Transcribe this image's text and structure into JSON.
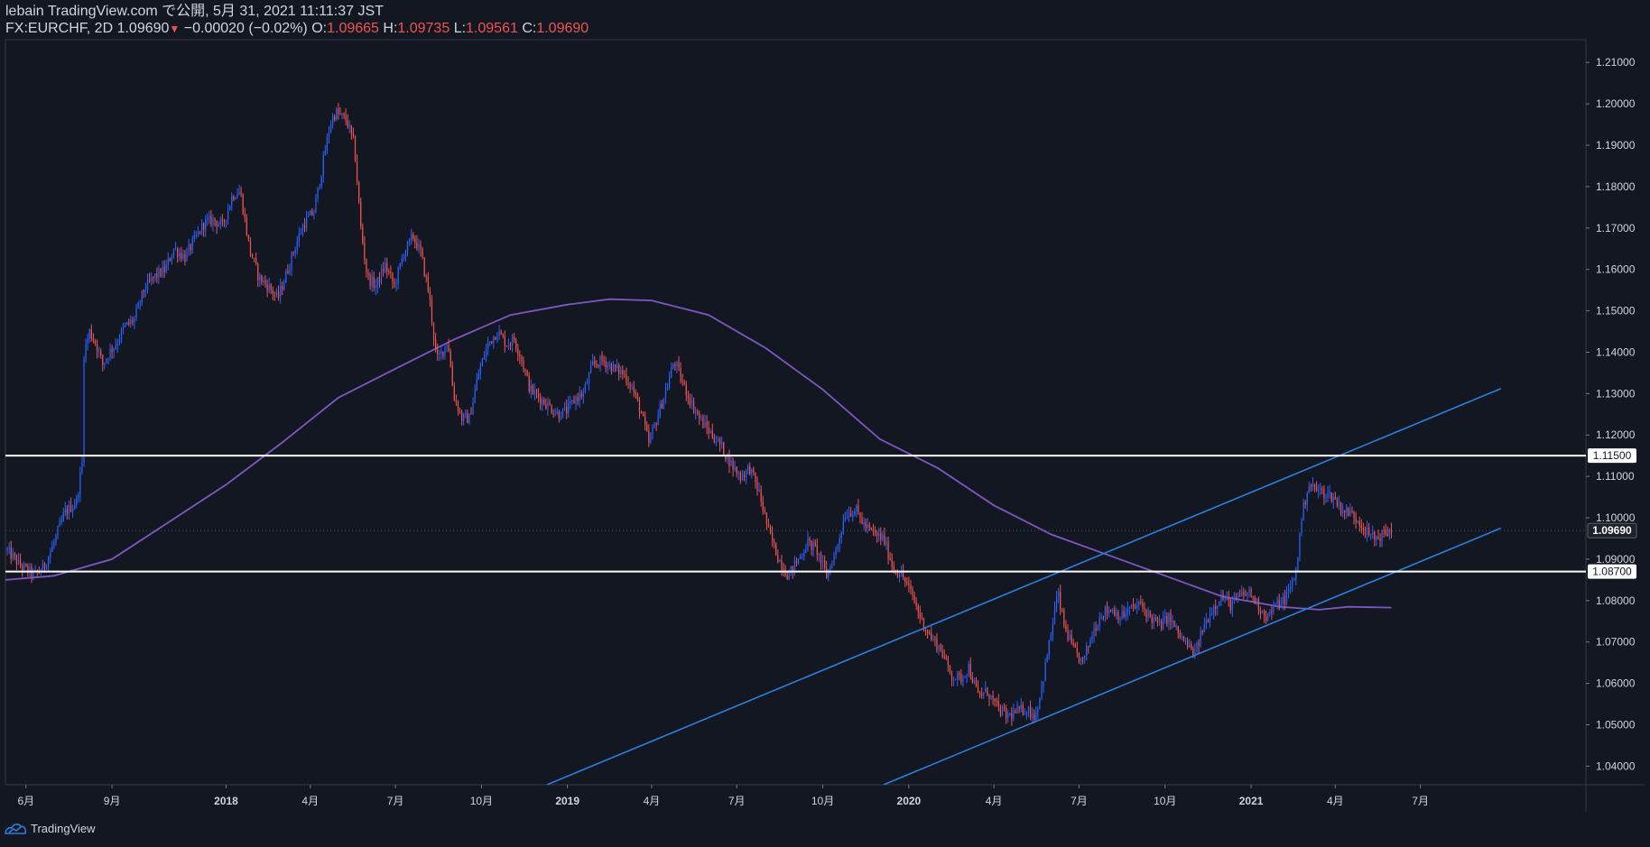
{
  "header": {
    "line1": "lebain TradingView.com で公開, 5月 31, 2021 11:11:37 JST",
    "symbol": "FX:EURCHF, 2D 1.09690",
    "arrow": "▼",
    "change": "−0.00020 (−0.02%)",
    "o_label": "O:",
    "o_value": "1.09665",
    "h_label": "H:",
    "h_value": "1.09735",
    "l_label": "L:",
    "l_value": "1.09561",
    "c_label": "C:",
    "c_value": "1.09690"
  },
  "footer": {
    "brand": "TradingView"
  },
  "colors": {
    "background": "#131722",
    "up": "#2962ff",
    "down": "#ef5350",
    "ma": "#7e57c2",
    "trendline": "#2a7fdf",
    "level": "#ffffff",
    "text": "#d1d4dc"
  },
  "chart_data": {
    "type": "candlestick",
    "symbol": "FX:EURCHF",
    "interval": "2D",
    "ylim": [
      1.0355,
      1.2155
    ],
    "y_ticks": [
      "1.21000",
      "1.20000",
      "1.19000",
      "1.18000",
      "1.17000",
      "1.16000",
      "1.15000",
      "1.14000",
      "1.13000",
      "1.12000",
      "1.11000",
      "1.10000",
      "1.09000",
      "1.08000",
      "1.07000",
      "1.06000",
      "1.05000",
      "1.04000"
    ],
    "x_ticks": [
      {
        "label": "6月",
        "date": "2017-06-01",
        "bold": false
      },
      {
        "label": "9月",
        "date": "2017-09-01",
        "bold": false
      },
      {
        "label": "2018",
        "date": "2018-01-01",
        "bold": true
      },
      {
        "label": "4月",
        "date": "2018-04-01",
        "bold": false
      },
      {
        "label": "7月",
        "date": "2018-07-01",
        "bold": false
      },
      {
        "label": "10月",
        "date": "2018-10-01",
        "bold": false
      },
      {
        "label": "2019",
        "date": "2019-01-01",
        "bold": true
      },
      {
        "label": "4月",
        "date": "2019-04-01",
        "bold": false
      },
      {
        "label": "7月",
        "date": "2019-07-01",
        "bold": false
      },
      {
        "label": "10月",
        "date": "2019-10-01",
        "bold": false
      },
      {
        "label": "2020",
        "date": "2020-01-01",
        "bold": true
      },
      {
        "label": "4月",
        "date": "2020-04-01",
        "bold": false
      },
      {
        "label": "7月",
        "date": "2020-07-01",
        "bold": false
      },
      {
        "label": "10月",
        "date": "2020-10-01",
        "bold": false
      },
      {
        "label": "2021",
        "date": "2021-01-01",
        "bold": true
      },
      {
        "label": "4月",
        "date": "2021-04-01",
        "bold": false
      },
      {
        "label": "7月",
        "date": "2021-07-01",
        "bold": false
      }
    ],
    "close_path": [
      [
        "2017-05-12",
        1.092
      ],
      [
        "2017-05-28",
        1.088
      ],
      [
        "2017-06-10",
        1.0862
      ],
      [
        "2017-06-20",
        1.088
      ],
      [
        "2017-07-01",
        1.094
      ],
      [
        "2017-07-12",
        1.101
      ],
      [
        "2017-07-25",
        1.104
      ],
      [
        "2017-07-31",
        1.113
      ],
      [
        "2017-08-02",
        1.14
      ],
      [
        "2017-08-08",
        1.145
      ],
      [
        "2017-08-15",
        1.142
      ],
      [
        "2017-08-22",
        1.137
      ],
      [
        "2017-08-29",
        1.14
      ],
      [
        "2017-09-05",
        1.142
      ],
      [
        "2017-09-14",
        1.146
      ],
      [
        "2017-09-25",
        1.148
      ],
      [
        "2017-10-05",
        1.155
      ],
      [
        "2017-10-15",
        1.158
      ],
      [
        "2017-10-28",
        1.16
      ],
      [
        "2017-11-06",
        1.165
      ],
      [
        "2017-11-18",
        1.163
      ],
      [
        "2017-11-28",
        1.167
      ],
      [
        "2017-12-08",
        1.171
      ],
      [
        "2017-12-18",
        1.172
      ],
      [
        "2017-12-28",
        1.1705
      ],
      [
        "2018-01-08",
        1.178
      ],
      [
        "2018-01-16",
        1.179
      ],
      [
        "2018-01-26",
        1.165
      ],
      [
        "2018-02-05",
        1.158
      ],
      [
        "2018-02-15",
        1.156
      ],
      [
        "2018-02-25",
        1.153
      ],
      [
        "2018-03-05",
        1.158
      ],
      [
        "2018-03-15",
        1.165
      ],
      [
        "2018-03-25",
        1.171
      ],
      [
        "2018-04-05",
        1.174
      ],
      [
        "2018-04-14",
        1.185
      ],
      [
        "2018-04-22",
        1.195
      ],
      [
        "2018-04-28",
        1.198
      ],
      [
        "2018-05-10",
        1.196
      ],
      [
        "2018-05-18",
        1.19
      ],
      [
        "2018-05-25",
        1.17
      ],
      [
        "2018-06-01",
        1.158
      ],
      [
        "2018-06-10",
        1.156
      ],
      [
        "2018-06-20",
        1.161
      ],
      [
        "2018-06-30",
        1.156
      ],
      [
        "2018-07-10",
        1.164
      ],
      [
        "2018-07-20",
        1.168
      ],
      [
        "2018-07-28",
        1.164
      ],
      [
        "2018-08-06",
        1.154
      ],
      [
        "2018-08-14",
        1.138
      ],
      [
        "2018-08-20",
        1.14
      ],
      [
        "2018-08-26",
        1.143
      ],
      [
        "2018-09-01",
        1.13
      ],
      [
        "2018-09-10",
        1.124
      ],
      [
        "2018-09-18",
        1.124
      ],
      [
        "2018-09-28",
        1.135
      ],
      [
        "2018-10-08",
        1.142
      ],
      [
        "2018-10-18",
        1.145
      ],
      [
        "2018-10-28",
        1.142
      ],
      [
        "2018-11-05",
        1.143
      ],
      [
        "2018-11-12",
        1.139
      ],
      [
        "2018-11-22",
        1.131
      ],
      [
        "2018-12-02",
        1.129
      ],
      [
        "2018-12-12",
        1.127
      ],
      [
        "2018-12-22",
        1.125
      ],
      [
        "2019-01-01",
        1.126
      ],
      [
        "2019-01-10",
        1.129
      ],
      [
        "2019-01-18",
        1.13
      ],
      [
        "2019-01-28",
        1.137
      ],
      [
        "2019-02-08",
        1.138
      ],
      [
        "2019-02-20",
        1.136
      ],
      [
        "2019-03-01",
        1.135
      ],
      [
        "2019-03-10",
        1.132
      ],
      [
        "2019-03-20",
        1.126
      ],
      [
        "2019-03-29",
        1.118
      ],
      [
        "2019-04-08",
        1.125
      ],
      [
        "2019-04-18",
        1.132
      ],
      [
        "2019-04-25",
        1.138
      ],
      [
        "2019-05-05",
        1.132
      ],
      [
        "2019-05-15",
        1.127
      ],
      [
        "2019-05-25",
        1.123
      ],
      [
        "2019-06-05",
        1.12
      ],
      [
        "2019-06-15",
        1.117
      ],
      [
        "2019-06-25",
        1.113
      ],
      [
        "2019-07-05",
        1.11
      ],
      [
        "2019-07-15",
        1.112
      ],
      [
        "2019-07-25",
        1.106
      ],
      [
        "2019-08-05",
        1.096
      ],
      [
        "2019-08-15",
        1.09
      ],
      [
        "2019-08-25",
        1.086
      ],
      [
        "2019-09-05",
        1.09
      ],
      [
        "2019-09-15",
        1.094
      ],
      [
        "2019-09-25",
        1.092
      ],
      [
        "2019-10-05",
        1.086
      ],
      [
        "2019-10-15",
        1.092
      ],
      [
        "2019-10-25",
        1.101
      ],
      [
        "2019-11-05",
        1.102
      ],
      [
        "2019-11-15",
        1.098
      ],
      [
        "2019-11-25",
        1.096
      ],
      [
        "2019-12-05",
        1.095
      ],
      [
        "2019-12-15",
        1.088
      ],
      [
        "2019-12-25",
        1.086
      ],
      [
        "2020-01-05",
        1.081
      ],
      [
        "2020-01-15",
        1.075
      ],
      [
        "2020-01-25",
        1.071
      ],
      [
        "2020-02-05",
        1.068
      ],
      [
        "2020-02-15",
        1.062
      ],
      [
        "2020-02-25",
        1.061
      ],
      [
        "2020-03-05",
        1.064
      ],
      [
        "2020-03-15",
        1.057
      ],
      [
        "2020-03-25",
        1.058
      ],
      [
        "2020-04-05",
        1.054
      ],
      [
        "2020-04-15",
        1.052
      ],
      [
        "2020-04-25",
        1.053
      ],
      [
        "2020-05-05",
        1.054
      ],
      [
        "2020-05-15",
        1.052
      ],
      [
        "2020-05-22",
        1.059
      ],
      [
        "2020-06-01",
        1.072
      ],
      [
        "2020-06-08",
        1.082
      ],
      [
        "2020-06-15",
        1.074
      ],
      [
        "2020-06-25",
        1.068
      ],
      [
        "2020-07-05",
        1.065
      ],
      [
        "2020-07-15",
        1.072
      ],
      [
        "2020-07-25",
        1.077
      ],
      [
        "2020-08-05",
        1.078
      ],
      [
        "2020-08-15",
        1.076
      ],
      [
        "2020-08-25",
        1.078
      ],
      [
        "2020-09-05",
        1.079
      ],
      [
        "2020-09-15",
        1.076
      ],
      [
        "2020-09-25",
        1.074
      ],
      [
        "2020-10-05",
        1.076
      ],
      [
        "2020-10-15",
        1.072
      ],
      [
        "2020-10-25",
        1.069
      ],
      [
        "2020-11-02",
        1.067
      ],
      [
        "2020-11-10",
        1.073
      ],
      [
        "2020-11-20",
        1.078
      ],
      [
        "2020-11-30",
        1.081
      ],
      [
        "2020-12-10",
        1.079
      ],
      [
        "2020-12-20",
        1.081
      ],
      [
        "2020-12-30",
        1.082
      ],
      [
        "2021-01-08",
        1.079
      ],
      [
        "2021-01-18",
        1.076
      ],
      [
        "2021-01-28",
        1.079
      ],
      [
        "2021-02-05",
        1.08
      ],
      [
        "2021-02-12",
        1.083
      ],
      [
        "2021-02-18",
        1.087
      ],
      [
        "2021-02-24",
        1.1
      ],
      [
        "2021-03-03",
        1.108
      ],
      [
        "2021-03-10",
        1.107
      ],
      [
        "2021-03-20",
        1.106
      ],
      [
        "2021-03-30",
        1.105
      ],
      [
        "2021-04-08",
        1.102
      ],
      [
        "2021-04-18",
        1.101
      ],
      [
        "2021-04-28",
        1.099
      ],
      [
        "2021-05-06",
        1.096
      ],
      [
        "2021-05-14",
        1.095
      ],
      [
        "2021-05-22",
        1.096
      ],
      [
        "2021-05-31",
        1.0969
      ]
    ],
    "moving_average": [
      [
        "2017-05-10",
        1.085
      ],
      [
        "2017-07-01",
        1.086
      ],
      [
        "2017-09-01",
        1.09
      ],
      [
        "2017-11-01",
        1.099
      ],
      [
        "2018-01-01",
        1.108
      ],
      [
        "2018-03-01",
        1.118
      ],
      [
        "2018-05-01",
        1.129
      ],
      [
        "2018-07-01",
        1.136
      ],
      [
        "2018-09-01",
        1.143
      ],
      [
        "2018-11-01",
        1.149
      ],
      [
        "2019-01-01",
        1.1515
      ],
      [
        "2019-02-15",
        1.1528
      ],
      [
        "2019-04-01",
        1.1525
      ],
      [
        "2019-06-01",
        1.149
      ],
      [
        "2019-08-01",
        1.141
      ],
      [
        "2019-10-01",
        1.131
      ],
      [
        "2019-12-01",
        1.119
      ],
      [
        "2020-02-01",
        1.112
      ],
      [
        "2020-04-01",
        1.103
      ],
      [
        "2020-06-01",
        1.096
      ],
      [
        "2020-08-01",
        1.091
      ],
      [
        "2020-10-01",
        1.086
      ],
      [
        "2020-12-01",
        1.081
      ],
      [
        "2021-02-01",
        1.0785
      ],
      [
        "2021-03-15",
        1.0778
      ],
      [
        "2021-04-15",
        1.0785
      ],
      [
        "2021-05-31",
        1.0783
      ]
    ],
    "horizontal_levels": [
      {
        "price": 1.115,
        "label": "1.11500"
      },
      {
        "price": 1.087,
        "label": "1.08700"
      }
    ],
    "last_price": {
      "price": 1.0969,
      "label": "1.09690"
    },
    "trendlines": [
      {
        "from": [
          "2018-12-10",
          1.0355
        ],
        "to": [
          "2021-09-25",
          1.1312
        ]
      },
      {
        "from": [
          "2019-12-05",
          1.0355
        ],
        "to": [
          "2021-09-25",
          1.0975
        ]
      }
    ]
  }
}
